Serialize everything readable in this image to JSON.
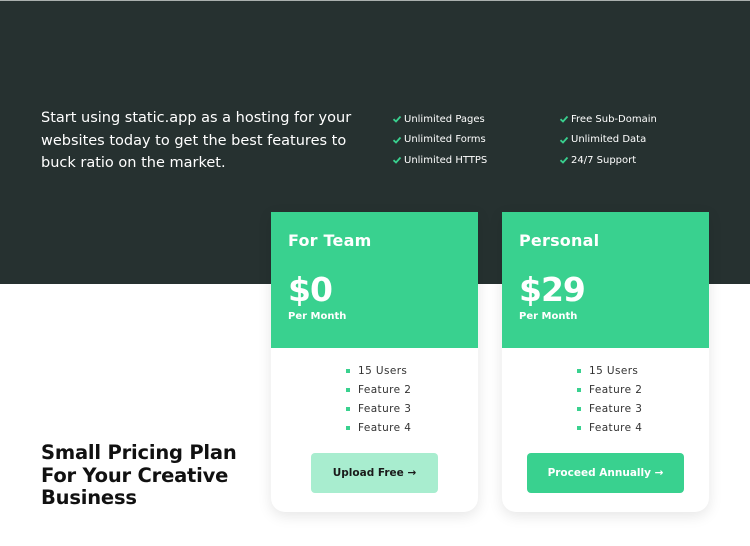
{
  "colors": {
    "dark_background": "#263130",
    "accent_green": "#39d18f",
    "light_green": "#a8edcf"
  },
  "intro": {
    "text": "Start using static.app as a hosting for your websites today to get the best features to buck ratio on the market."
  },
  "features": {
    "column1": [
      {
        "icon": "check-icon",
        "label": "Unlimited Pages"
      },
      {
        "icon": "check-icon",
        "label": "Unlimited Forms"
      },
      {
        "icon": "check-icon",
        "label": "Unlimited HTTPS"
      }
    ],
    "column2": [
      {
        "icon": "check-icon",
        "label": "Free Sub-Domain"
      },
      {
        "icon": "check-icon",
        "label": "Unlimited Data"
      },
      {
        "icon": "check-icon",
        "label": "24/7 Support"
      }
    ]
  },
  "headline": {
    "text": "Small Pricing Plan For Your Creative Business"
  },
  "plans": [
    {
      "name": "For Team",
      "price": "$0",
      "period": "Per Month",
      "items": [
        "15 Users",
        "Feature 2",
        "Feature 3",
        "Feature 4"
      ],
      "button": "Upload Free →"
    },
    {
      "name": "Personal",
      "price": "$29",
      "period": "Per Month",
      "items": [
        "15 Users",
        "Feature 2",
        "Feature 3",
        "Feature 4"
      ],
      "button": "Proceed Annually →"
    }
  ]
}
